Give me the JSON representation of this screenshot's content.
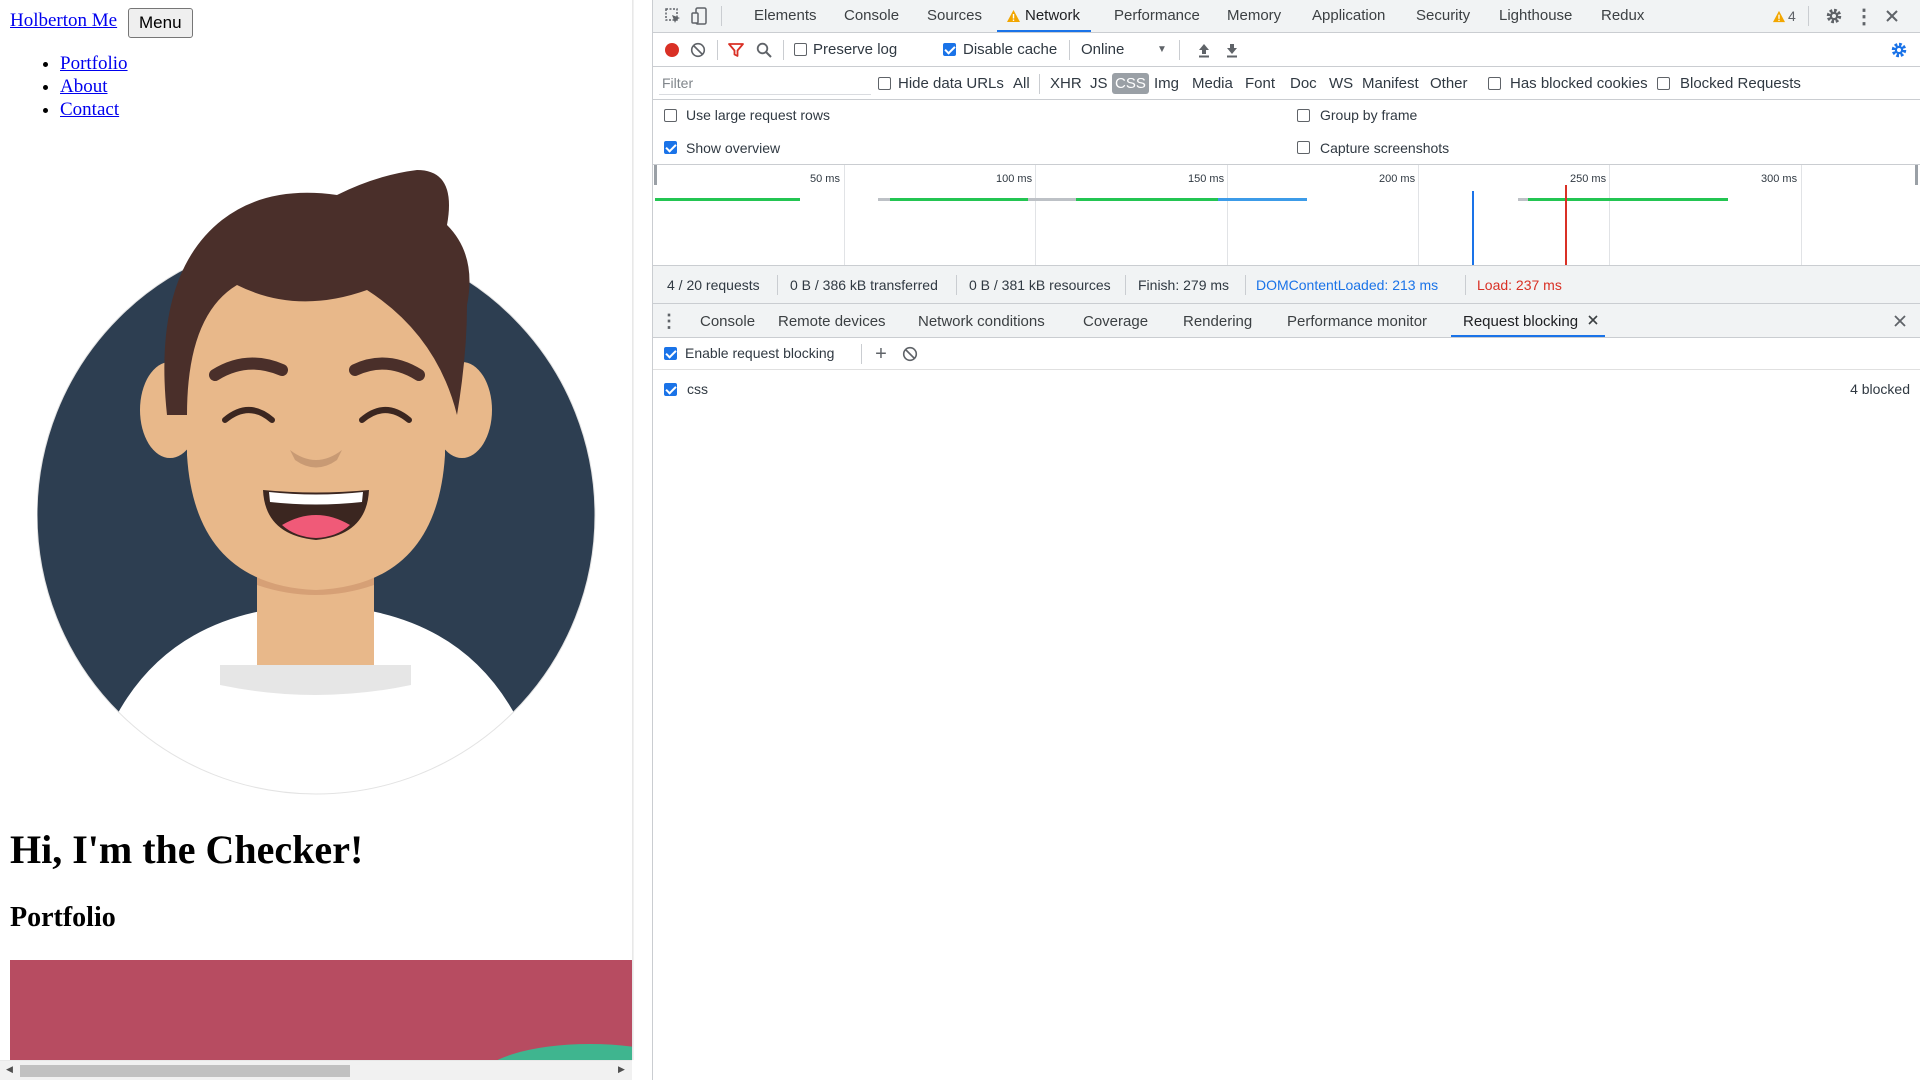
{
  "page": {
    "brand": "Holberton Me",
    "menu_button": "Menu",
    "nav": [
      "Portfolio",
      "About",
      "Contact"
    ],
    "hero_title": "Hi, I'm the Checker!",
    "section_title": "Portfolio"
  },
  "devtools": {
    "tabs": [
      "Elements",
      "Console",
      "Sources",
      "Network",
      "Performance",
      "Memory",
      "Application",
      "Security",
      "Lighthouse",
      "Redux"
    ],
    "active_tab": "Network",
    "warning_count": "4",
    "toolbar": {
      "preserve_log": "Preserve log",
      "disable_cache": "Disable cache",
      "throttling": "Online"
    },
    "filter": {
      "placeholder": "Filter",
      "hide_data_urls": "Hide data URLs",
      "types": [
        "All",
        "XHR",
        "JS",
        "CSS",
        "Img",
        "Media",
        "Font",
        "Doc",
        "WS",
        "Manifest",
        "Other"
      ],
      "active_type": "CSS",
      "has_blocked_cookies": "Has blocked cookies",
      "blocked_requests": "Blocked Requests"
    },
    "settings": {
      "use_large_rows": "Use large request rows",
      "show_overview": "Show overview",
      "group_by_frame": "Group by frame",
      "capture_screenshots": "Capture screenshots"
    },
    "overview": {
      "ticks": [
        "50 ms",
        "100 ms",
        "150 ms",
        "200 ms",
        "250 ms",
        "300 ms"
      ]
    },
    "summary": {
      "requests": "4 / 20 requests",
      "transferred": "0 B / 386 kB transferred",
      "resources": "0 B / 381 kB resources",
      "finish": "Finish: 279 ms",
      "dom_content_loaded": "DOMContentLoaded: 213 ms",
      "load": "Load: 237 ms"
    },
    "drawer": {
      "tabs": [
        "Console",
        "Remote devices",
        "Network conditions",
        "Coverage",
        "Rendering",
        "Performance monitor",
        "Request blocking"
      ],
      "active_tab": "Request blocking",
      "enable_blocking": "Enable request blocking",
      "patterns": [
        {
          "pattern": "css",
          "status": "4 blocked",
          "enabled": true
        }
      ]
    },
    "colors": {
      "accent": "#1a73e8",
      "record": "#d93025",
      "dcl": "#1a73e8",
      "load": "#d93025",
      "green": "#23c552",
      "blue": "#3c9be8"
    }
  }
}
